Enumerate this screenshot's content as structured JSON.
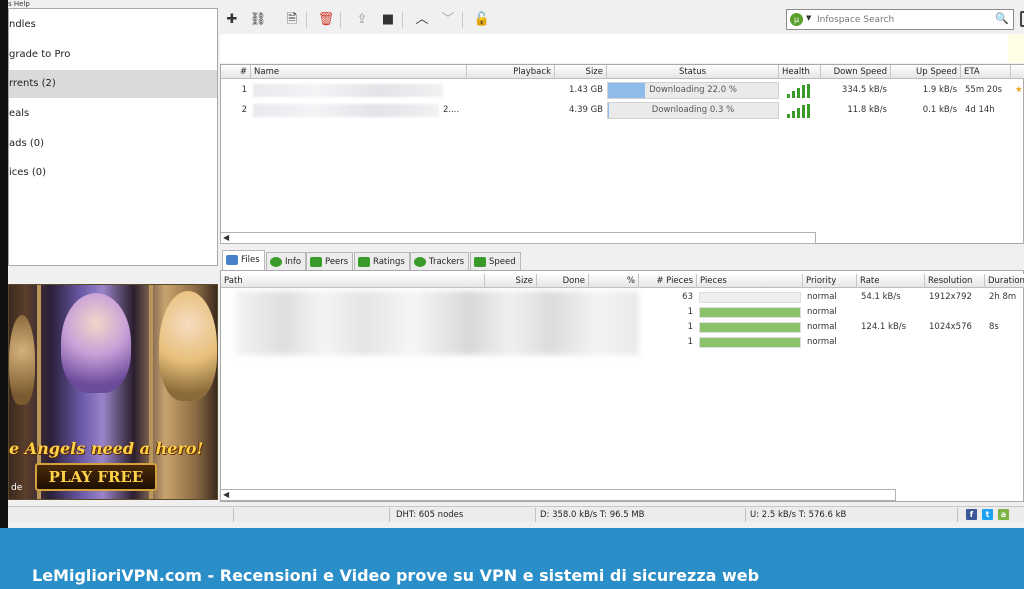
{
  "menu": {
    "fragment": "s Help"
  },
  "sidebar": {
    "items": [
      {
        "label": "ndles"
      },
      {
        "label": "grade to Pro"
      },
      {
        "label": "rrents (2)"
      },
      {
        "label": "eals"
      },
      {
        "label": "ads (0)"
      },
      {
        "label": "ices (0)"
      }
    ]
  },
  "ad": {
    "tagline": "e Angels need a hero!",
    "button": "PLAY FREE",
    "small_text": "de"
  },
  "toolbar": {
    "search_placeholder": "Infospace Search"
  },
  "torrents": {
    "columns": [
      "#",
      "Name",
      "Playback",
      "Size",
      "Status",
      "Health",
      "Down Speed",
      "Up Speed",
      "ETA"
    ],
    "rows": [
      {
        "num": "1",
        "name_tail": "",
        "size": "1.43 GB",
        "status": "Downloading 22.0 %",
        "progress": 0.22,
        "down": "334.5 kB/s",
        "up": "1.9 kB/s",
        "eta": "55m 20s"
      },
      {
        "num": "2",
        "name_tail": "2....",
        "size": "4.39 GB",
        "status": "Downloading 0.3 %",
        "progress": 0.003,
        "down": "11.8 kB/s",
        "up": "0.1 kB/s",
        "eta": "4d 14h"
      }
    ]
  },
  "tabs": [
    {
      "label": "Files",
      "icon": "files-icon",
      "color": "#4a7fc9"
    },
    {
      "label": "Info",
      "icon": "info-icon",
      "color": "#3a9a2a"
    },
    {
      "label": "Peers",
      "icon": "peers-icon",
      "color": "#3a9a2a"
    },
    {
      "label": "Ratings",
      "icon": "ratings-icon",
      "color": "#3a9a2a"
    },
    {
      "label": "Trackers",
      "icon": "trackers-icon",
      "color": "#3a9a2a"
    },
    {
      "label": "Speed",
      "icon": "speed-icon",
      "color": "#3a9a2a"
    }
  ],
  "files": {
    "columns": [
      "Path",
      "Size",
      "Done",
      "%",
      "# Pieces",
      "Pieces",
      "Priority",
      "Rate",
      "Resolution",
      "Duration"
    ],
    "rows": [
      {
        "pieces": "63",
        "fill": 0.0,
        "priority": "normal",
        "rate": "54.1 kB/s",
        "resolution": "1912x792",
        "duration": "2h 8m"
      },
      {
        "pieces": "1",
        "fill": 1.0,
        "priority": "normal",
        "rate": "",
        "resolution": "",
        "duration": ""
      },
      {
        "pieces": "1",
        "fill": 1.0,
        "priority": "normal",
        "rate": "124.1 kB/s",
        "resolution": "1024x576",
        "duration": "8s"
      },
      {
        "pieces": "1",
        "fill": 1.0,
        "priority": "normal",
        "rate": "",
        "resolution": "",
        "duration": ""
      }
    ]
  },
  "statusbar": {
    "dht": "DHT: 605 nodes",
    "down": "D: 358.0 kB/s T: 96.5 MB",
    "up": "U: 2.5 kB/s T: 576.6 kB"
  },
  "footer": {
    "text": "LeMiglioriVPN.com - Recensioni e Video prove su VPN e sistemi di sicurezza web"
  },
  "colors": {
    "accent_blue": "#8fbbe9",
    "pieces_green": "#8cc26a",
    "health_green": "#3a9a2a",
    "footer_blue": "#2a8ec8"
  }
}
